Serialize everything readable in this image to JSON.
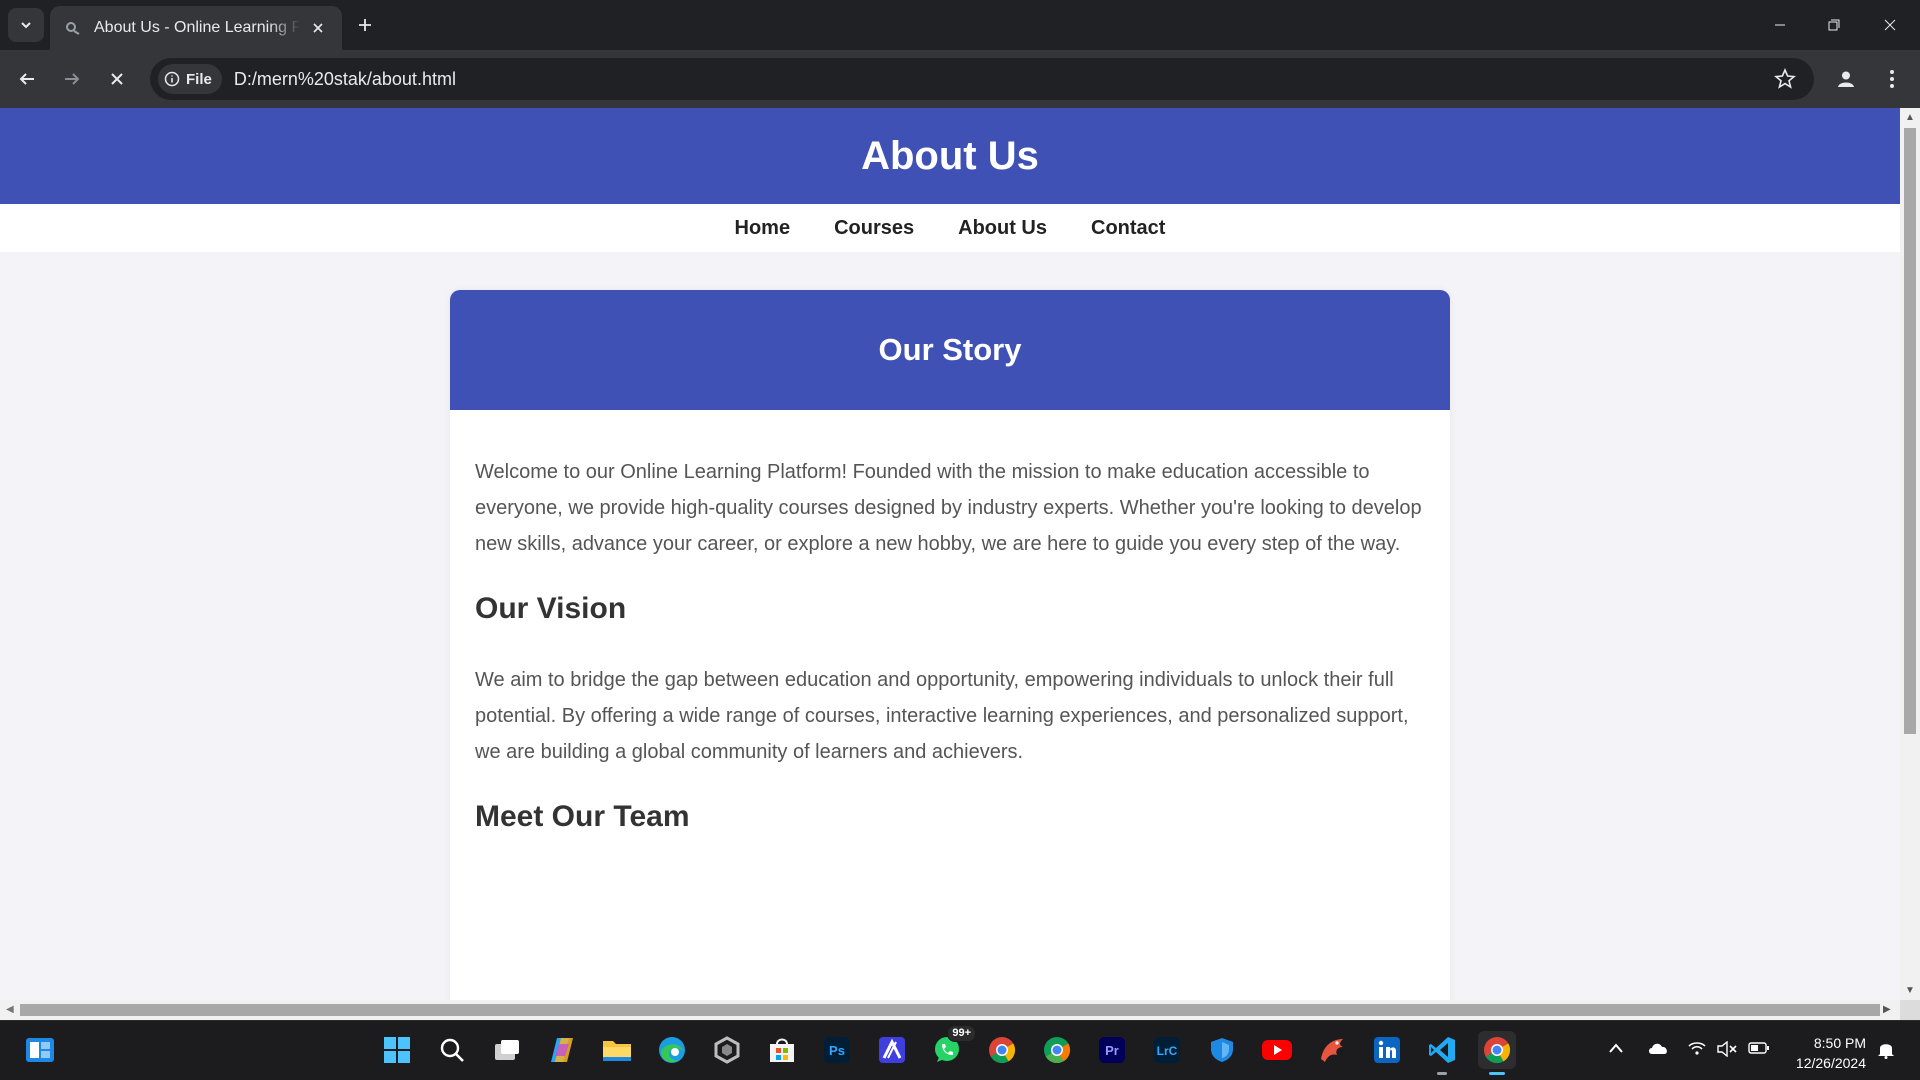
{
  "browser": {
    "tab_title": "About Us - Online Learning Platform",
    "new_tab_label": "+",
    "omnibox": {
      "scheme_chip": "File",
      "url": "D:/mern%20stak/about.html"
    }
  },
  "page": {
    "header_title": "About Us",
    "nav": [
      "Home",
      "Courses",
      "About Us",
      "Contact"
    ],
    "card_title": "Our Story",
    "intro": "Welcome to our Online Learning Platform! Founded with the mission to make education accessible to everyone, we provide high-quality courses designed by industry experts. Whether you're looking to develop new skills, advance your career, or explore a new hobby, we are here to guide you every step of the way.",
    "vision_heading": "Our Vision",
    "vision_text": "We aim to bridge the gap between education and opportunity, empowering individuals to unlock their full potential. By offering a wide range of courses, interactive learning experiences, and personalized support, we are building a global community of learners and achievers.",
    "team_heading": "Meet Our Team"
  },
  "taskbar": {
    "whatsapp_badge": "99+",
    "apps": [
      "start",
      "search",
      "task-view",
      "copilot",
      "file-explorer",
      "edge",
      "app",
      "store",
      "photoshop",
      "app-a",
      "whatsapp",
      "chrome",
      "chrome-alt",
      "premiere",
      "lightroom",
      "defender",
      "youtube",
      "app-dragon",
      "linkedin",
      "vscode",
      "chrome-active"
    ],
    "clock_time": "8:50 PM",
    "clock_date": "12/26/2024"
  },
  "colors": {
    "brand": "#3f51b5",
    "page_bg": "#f4f4f8",
    "chrome_dark": "#202124"
  }
}
